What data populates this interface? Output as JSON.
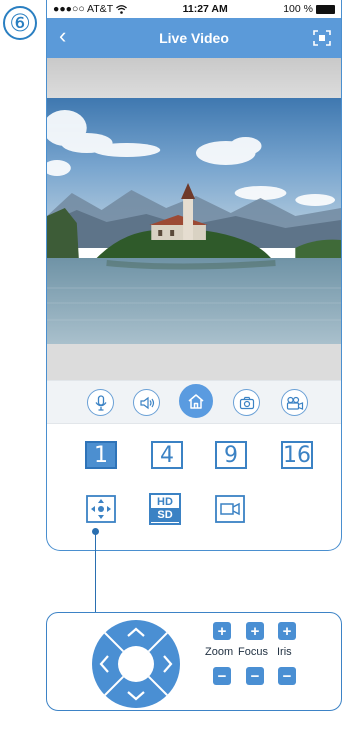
{
  "step_number": "⑥",
  "status_bar": {
    "carrier": "●●●○○ AT&T",
    "time": "11:27 AM",
    "battery": "100 %"
  },
  "nav": {
    "back_icon": "chevron-left-icon",
    "title": "Live Video",
    "fullscreen_icon": "fullscreen-icon"
  },
  "controls": [
    {
      "name": "microphone-icon"
    },
    {
      "name": "speaker-icon"
    },
    {
      "name": "home-icon",
      "active": true
    },
    {
      "name": "camera-icon"
    },
    {
      "name": "record-icon"
    }
  ],
  "grid_buttons": [
    "1",
    "4",
    "9",
    "16"
  ],
  "grid_active": "1",
  "tools": {
    "ptz_icon": "ptz-icon",
    "hd_label": "HD",
    "sd_label": "SD",
    "video_icon": "video-camera-icon"
  },
  "ptz_panel": {
    "zoom_label": "Zoom",
    "focus_label": "Focus",
    "iris_label": "Iris",
    "plus": "+",
    "minus": "−"
  },
  "colors": {
    "accent": "#5b9ad9",
    "button_border": "#3b82c4",
    "active_fill": "#4c8fd0"
  }
}
